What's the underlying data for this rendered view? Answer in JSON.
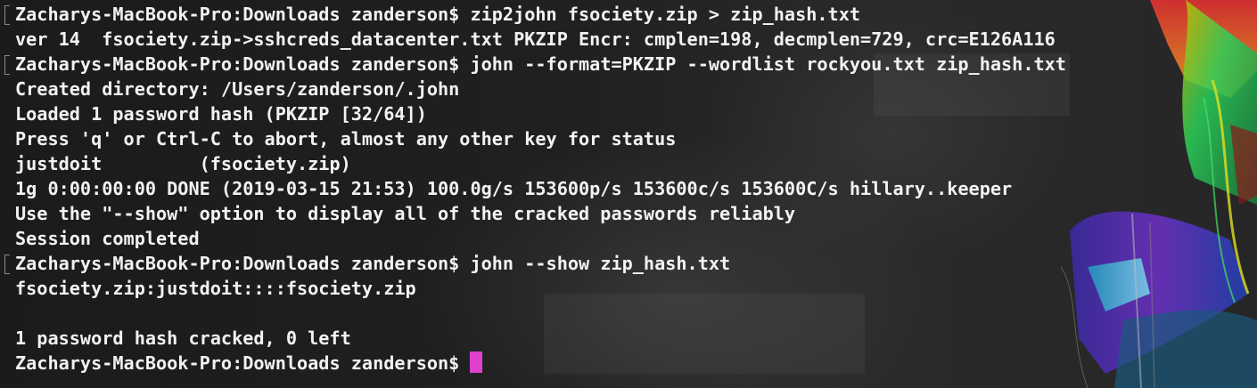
{
  "terminal": {
    "lines": [
      {
        "type": "command",
        "prompt": "Zacharys-MacBook-Pro:Downloads zanderson$",
        "text": "zip2john fsociety.zip > zip_hash.txt"
      },
      {
        "type": "output",
        "text": "ver 14  fsociety.zip->sshcreds_datacenter.txt PKZIP Encr: cmplen=198, decmplen=729, crc=E126A116"
      },
      {
        "type": "command",
        "prompt": "Zacharys-MacBook-Pro:Downloads zanderson$",
        "text": "john --format=PKZIP --wordlist rockyou.txt zip_hash.txt"
      },
      {
        "type": "output",
        "text": "Created directory: /Users/zanderson/.john"
      },
      {
        "type": "output",
        "text": "Loaded 1 password hash (PKZIP [32/64])"
      },
      {
        "type": "output",
        "text": "Press 'q' or Ctrl-C to abort, almost any other key for status"
      },
      {
        "type": "output",
        "text": "justdoit         (fsociety.zip)"
      },
      {
        "type": "output",
        "text": "1g 0:00:00:00 DONE (2019-03-15 21:53) 100.0g/s 153600p/s 153600c/s 153600C/s hillary..keeper"
      },
      {
        "type": "output",
        "text": "Use the \"--show\" option to display all of the cracked passwords reliably"
      },
      {
        "type": "output",
        "text": "Session completed"
      },
      {
        "type": "command",
        "prompt": "Zacharys-MacBook-Pro:Downloads zanderson$",
        "text": "john --show zip_hash.txt"
      },
      {
        "type": "output",
        "text": "fsociety.zip:justdoit::::fsociety.zip"
      },
      {
        "type": "output",
        "text": ""
      },
      {
        "type": "output",
        "text": "1 password hash cracked, 0 left"
      }
    ],
    "current_prompt": "Zacharys-MacBook-Pro:Downloads zanderson$",
    "cursor_color": "#e040d0",
    "text_color": "#f2f2f2"
  }
}
